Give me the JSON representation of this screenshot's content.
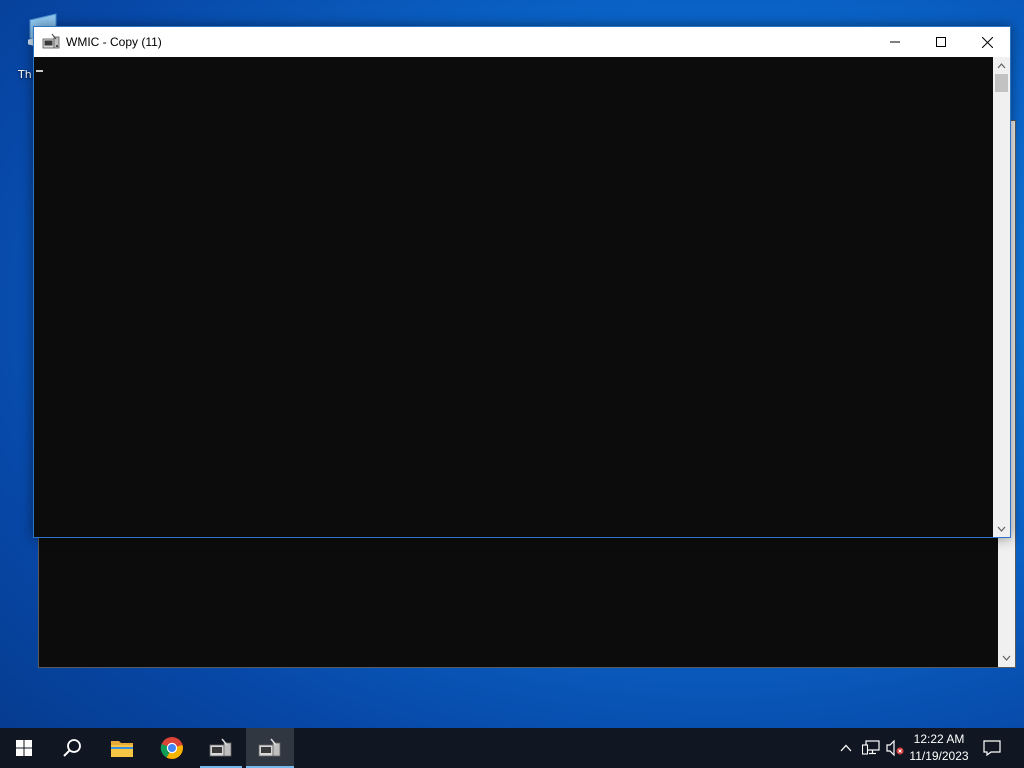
{
  "desktop": {
    "icon_label": "Th",
    "icon_name": "this-pc-icon"
  },
  "window": {
    "title": "WMIC - Copy (11)",
    "icon_name": "console-app-icon",
    "minimize_label": "Minimize",
    "maximize_label": "Maximize",
    "close_label": "Close",
    "console_text": ""
  },
  "taskbar": {
    "items": [
      {
        "name": "start",
        "icon": "windows-logo-icon"
      },
      {
        "name": "search",
        "icon": "search-icon"
      },
      {
        "name": "file-explorer",
        "icon": "folder-icon"
      },
      {
        "name": "chrome",
        "icon": "chrome-icon"
      },
      {
        "name": "wmic-1",
        "icon": "console-app-icon",
        "running": true
      },
      {
        "name": "wmic-2",
        "icon": "console-app-icon",
        "running": true,
        "active": true
      }
    ],
    "tray": {
      "icons": [
        "chevron-up-icon",
        "network-icon",
        "volume-muted-icon",
        "notification-icon"
      ],
      "time": "12:22 AM",
      "date": "11/19/2023"
    }
  },
  "colors": {
    "console_bg": "#0c0c0c",
    "taskbar_bg": "#101722",
    "accent": "#76b9ed"
  }
}
